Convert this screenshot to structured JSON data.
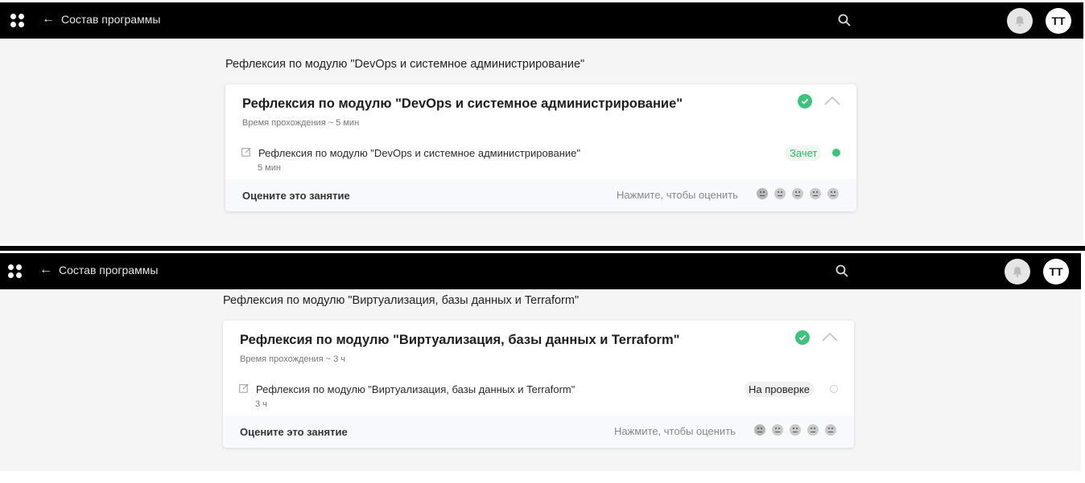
{
  "panels": [
    {
      "nav": {
        "back_label": "Состав программы",
        "avatar": "ТТ",
        "icons": [
          "app-logo-icon",
          "arrow-left-icon",
          "search-icon",
          "bell-icon"
        ]
      },
      "breadcrumb": "Рефлексия по модулю \"DevOps и системное администрирование\"",
      "card": {
        "title": "Рефлексия по модулю \"DevOps и системное администрирование\"",
        "duration": "Время прохождения ~ 5 мин",
        "item_title": "Рефлексия по модулю \"DevOps и системное администрирование\"",
        "item_duration": "5 мин",
        "status": "Зачет",
        "status_color": "#2fb36b",
        "rate_label": "Оцените это занятие",
        "rate_hint": "Нажмите, чтобы оценить"
      }
    },
    {
      "nav": {
        "back_label": "Состав программы",
        "avatar": "ТТ",
        "icons": [
          "app-logo-icon",
          "arrow-left-icon",
          "search-icon",
          "bell-icon"
        ]
      },
      "breadcrumb": "Рефлексия по модулю \"Виртуализация, базы данных и Terraform\"",
      "card": {
        "title": "Рефлексия по модулю \"Виртуализация, базы данных и Terraform\"",
        "duration": "Время прохождения ~ 3 ч",
        "item_title": "Рефлексия по модулю \"Виртуализация, базы данных и Terraform\"",
        "item_duration": "3 ч",
        "status": "На проверке",
        "status_color": "#222222",
        "rate_label": "Оцените это занятие",
        "rate_hint": "Нажмите, чтобы оценить"
      }
    }
  ],
  "accent_green": "#3cc47c"
}
